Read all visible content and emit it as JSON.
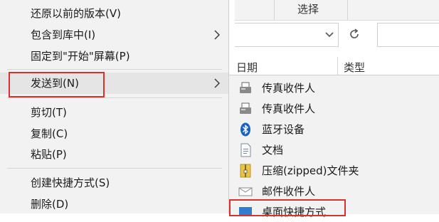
{
  "explorer": {
    "ribbon_label": "选择",
    "address_dropdown_icon": "chevron-down-icon",
    "refresh_icon": "refresh-icon",
    "columns": [
      "日期",
      "类型"
    ]
  },
  "context_menu": {
    "items": [
      {
        "label": "还原以前的版本(V)",
        "submenu": false
      },
      {
        "label": "包含到库中(I)",
        "submenu": true
      },
      {
        "label": "固定到\"开始\"屏幕(P)",
        "submenu": false
      },
      {
        "label": "发送到(N)",
        "submenu": true,
        "highlighted": true
      },
      {
        "label": "剪切(T)",
        "submenu": false
      },
      {
        "label": "复制(C)",
        "submenu": false
      },
      {
        "label": "粘贴(P)",
        "submenu": false
      },
      {
        "label": "创建快捷方式(S)",
        "submenu": false
      },
      {
        "label": "删除(D)",
        "submenu": false
      }
    ]
  },
  "send_to_menu": {
    "items": [
      {
        "label": "传真收件人",
        "icon": "fax-icon"
      },
      {
        "label": "传真收件人",
        "icon": "fax-icon"
      },
      {
        "label": "蓝牙设备",
        "icon": "bluetooth-icon"
      },
      {
        "label": "文档",
        "icon": "documents-icon"
      },
      {
        "label": "压缩(zipped)文件夹",
        "icon": "zip-folder-icon"
      },
      {
        "label": "邮件收件人",
        "icon": "mail-icon"
      },
      {
        "label": "桌面快捷方式",
        "icon": "desktop-icon"
      }
    ]
  },
  "colors": {
    "highlight_border": "#d8322c",
    "menu_bg": "#f2f2f2",
    "bluetooth": "#1565c0"
  }
}
